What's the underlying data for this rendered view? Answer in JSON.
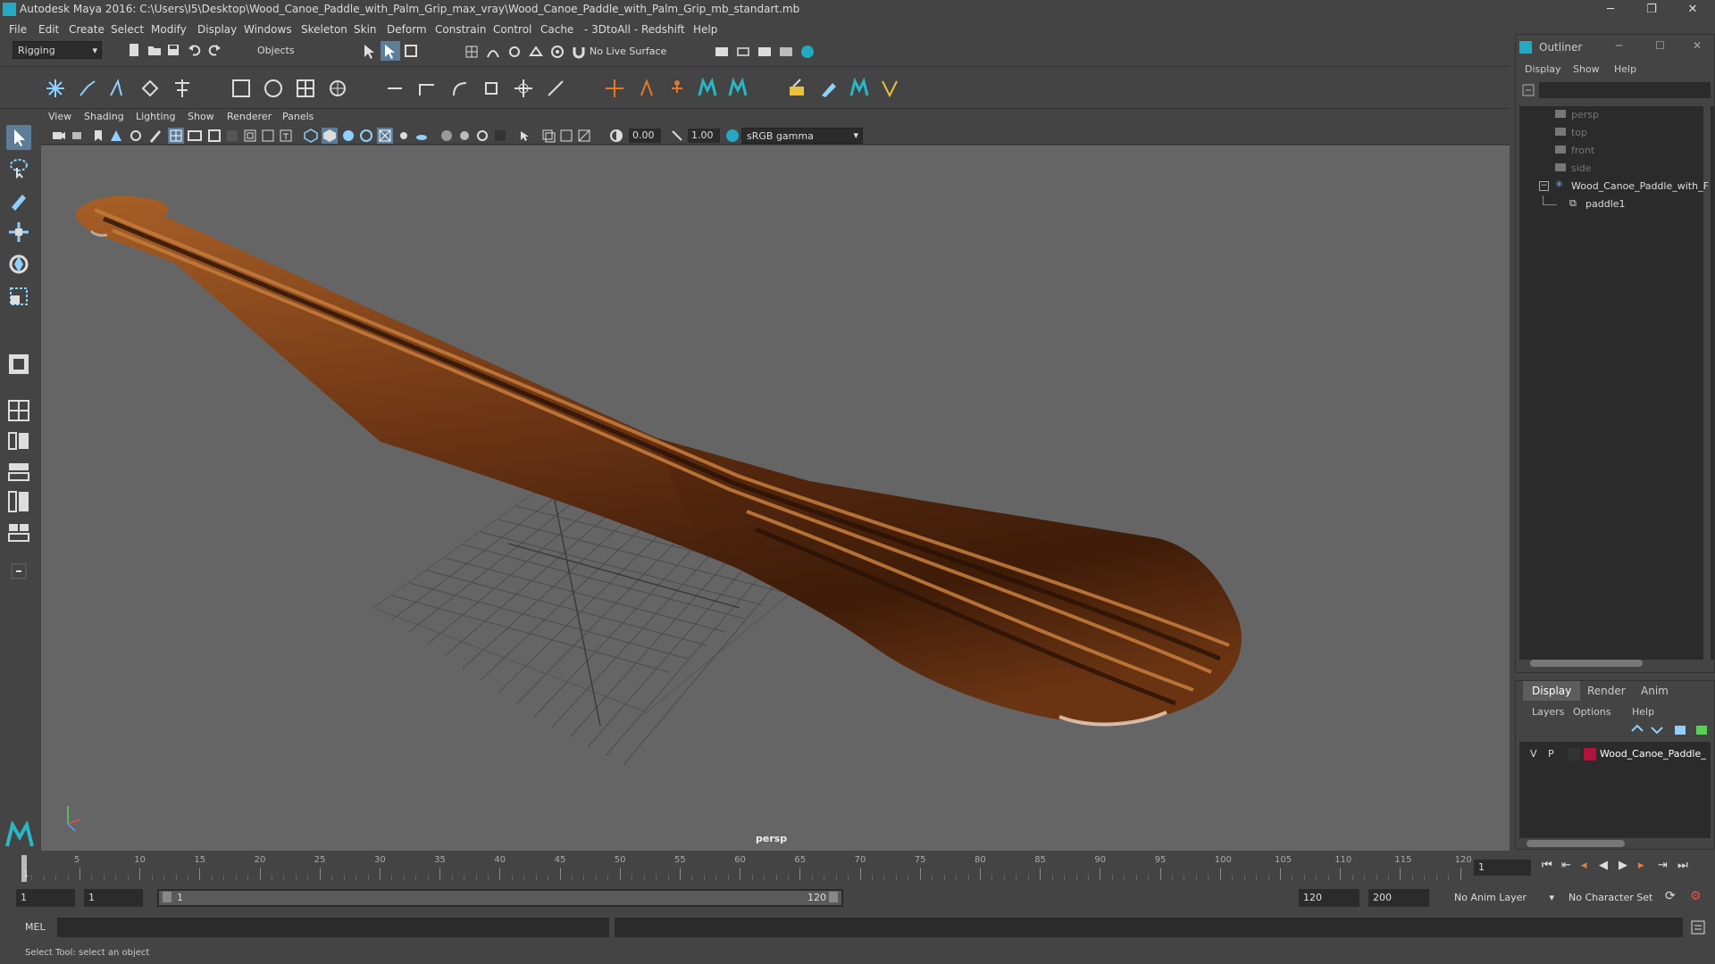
{
  "app": {
    "title": "Autodesk Maya 2016: C:\\Users\\I5\\Desktop\\Wood_Canoe_Paddle_with_Palm_Grip_max_vray\\Wood_Canoe_Paddle_with_Palm_Grip_mb_standart.mb",
    "min": "─",
    "restore": "❐",
    "close": "✕"
  },
  "menubar": [
    "File",
    "Edit",
    "Create",
    "Select",
    "Modify",
    "Display",
    "Windows",
    "Skeleton",
    "Skin",
    "Deform",
    "Constrain",
    "Control",
    "Cache",
    "- 3DtoAll -",
    "Redshift",
    "Help"
  ],
  "statusline": {
    "menuset": "Rigging",
    "selmode": "Objects",
    "live_surface": "No Live Surface"
  },
  "panel": {
    "menus": [
      "View",
      "Shading",
      "Lighting",
      "Show",
      "Renderer",
      "Panels"
    ],
    "exposure": "0.00",
    "gamma": "1.00",
    "colorspace": "sRGB gamma",
    "camera_label": "persp"
  },
  "timeslider": {
    "ticks": [
      "5",
      "10",
      "15",
      "20",
      "25",
      "30",
      "35",
      "40",
      "45",
      "50",
      "55",
      "60",
      "65",
      "70",
      "75",
      "80",
      "85",
      "90",
      "95",
      "100",
      "105",
      "110",
      "115",
      "120"
    ],
    "start_tick": "1",
    "current_frame": "1"
  },
  "range": {
    "start": "1",
    "playback_start": "1",
    "slider_start": "1",
    "slider_end": "120",
    "playback_end": "120",
    "end": "200",
    "anim_layer": "No Anim Layer",
    "char_set": "No Character Set"
  },
  "cmdline": {
    "lang": "MEL"
  },
  "helpline": {
    "text": "Select Tool: select an object"
  },
  "outliner": {
    "title": "Outliner",
    "menus": [
      "Display",
      "Show",
      "Help"
    ],
    "items": [
      "persp",
      "top",
      "front",
      "side",
      "Wood_Canoe_Paddle_with_F",
      "paddle1"
    ]
  },
  "layers": {
    "tabs": [
      "Display",
      "Render",
      "Anim"
    ],
    "menus": [
      "Layers",
      "Options",
      "Help"
    ],
    "layer_v": "V",
    "layer_p": "P",
    "layer_name": "Wood_Canoe_Paddle_",
    "layer_color": "#b0143a"
  }
}
